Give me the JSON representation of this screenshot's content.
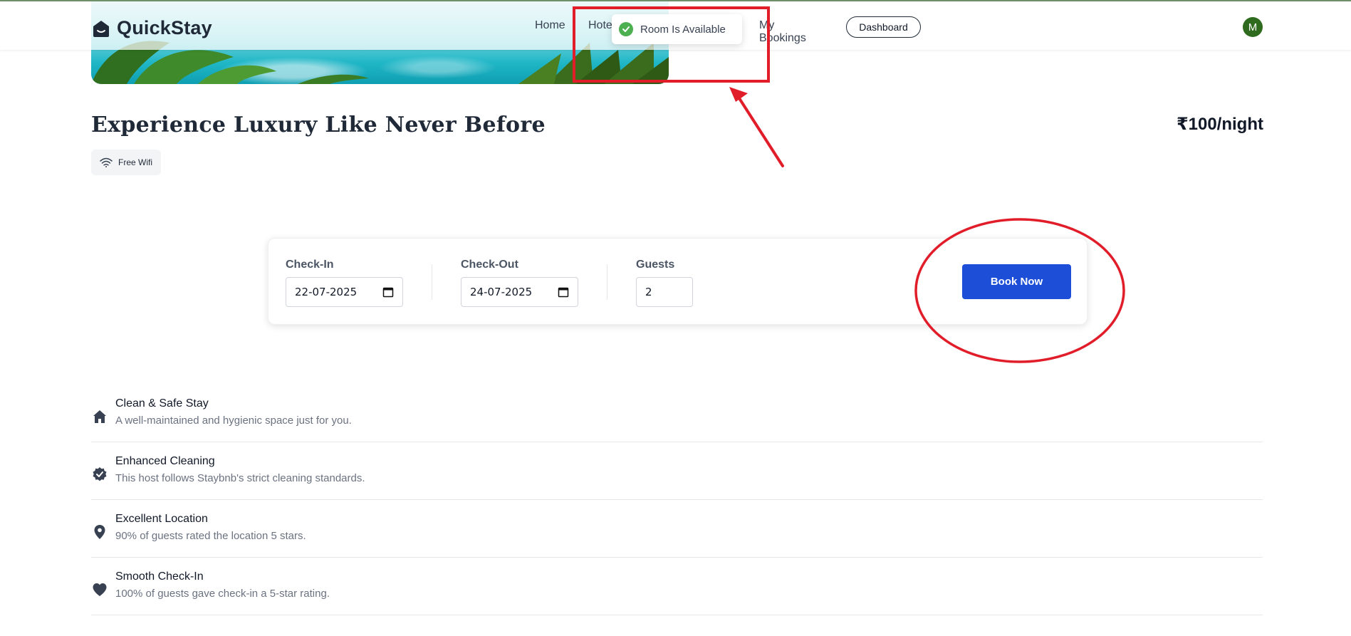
{
  "header": {
    "brand": "QuickStay",
    "nav": {
      "home": "Home",
      "hotels": "Hotels",
      "my_bookings": "My Bookings",
      "dashboard": "Dashboard"
    },
    "avatar_initial": "M"
  },
  "toast": {
    "message": "Room Is Available",
    "icon": "check-circle-icon",
    "color": "#4caf50"
  },
  "room": {
    "title": "Experience Luxury Like Never Before",
    "price": "₹100/night",
    "amenities": [
      {
        "label": "Free Wifi",
        "icon": "wifi-icon"
      }
    ]
  },
  "booking": {
    "check_in_label": "Check-In",
    "check_in_value": "22-07-2025",
    "check_out_label": "Check-Out",
    "check_out_value": "24-07-2025",
    "guests_label": "Guests",
    "guests_value": "2",
    "book_button": "Book Now",
    "button_color": "#1d4ed8"
  },
  "features": [
    {
      "icon": "home-icon",
      "title": "Clean & Safe Stay",
      "desc": "A well-maintained and hygienic space just for you."
    },
    {
      "icon": "badge-check-icon",
      "title": "Enhanced Cleaning",
      "desc": "This host follows Staybnb's strict cleaning standards."
    },
    {
      "icon": "location-pin-icon",
      "title": "Excellent Location",
      "desc": "90% of guests rated the location 5 stars."
    },
    {
      "icon": "heart-icon",
      "title": "Smooth Check-In",
      "desc": "100% of guests gave check-in a 5-star rating."
    }
  ],
  "annotation_color": "#e11d2a"
}
